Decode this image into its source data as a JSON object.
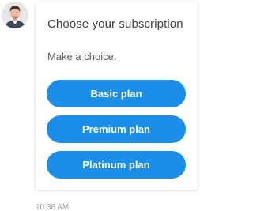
{
  "chat": {
    "avatar_icon": "user-avatar-icon",
    "message": {
      "title": "Choose your subscription",
      "subtitle": "Make a choice.",
      "options": [
        {
          "label": "Basic plan"
        },
        {
          "label": "Premium plan"
        },
        {
          "label": "Platinum plan"
        }
      ],
      "timestamp": "10:36 AM"
    }
  },
  "colors": {
    "button": "#1a8ee8",
    "button_text": "#ffffff",
    "title_text": "#424242",
    "timestamp_text": "#9e9e9e"
  }
}
